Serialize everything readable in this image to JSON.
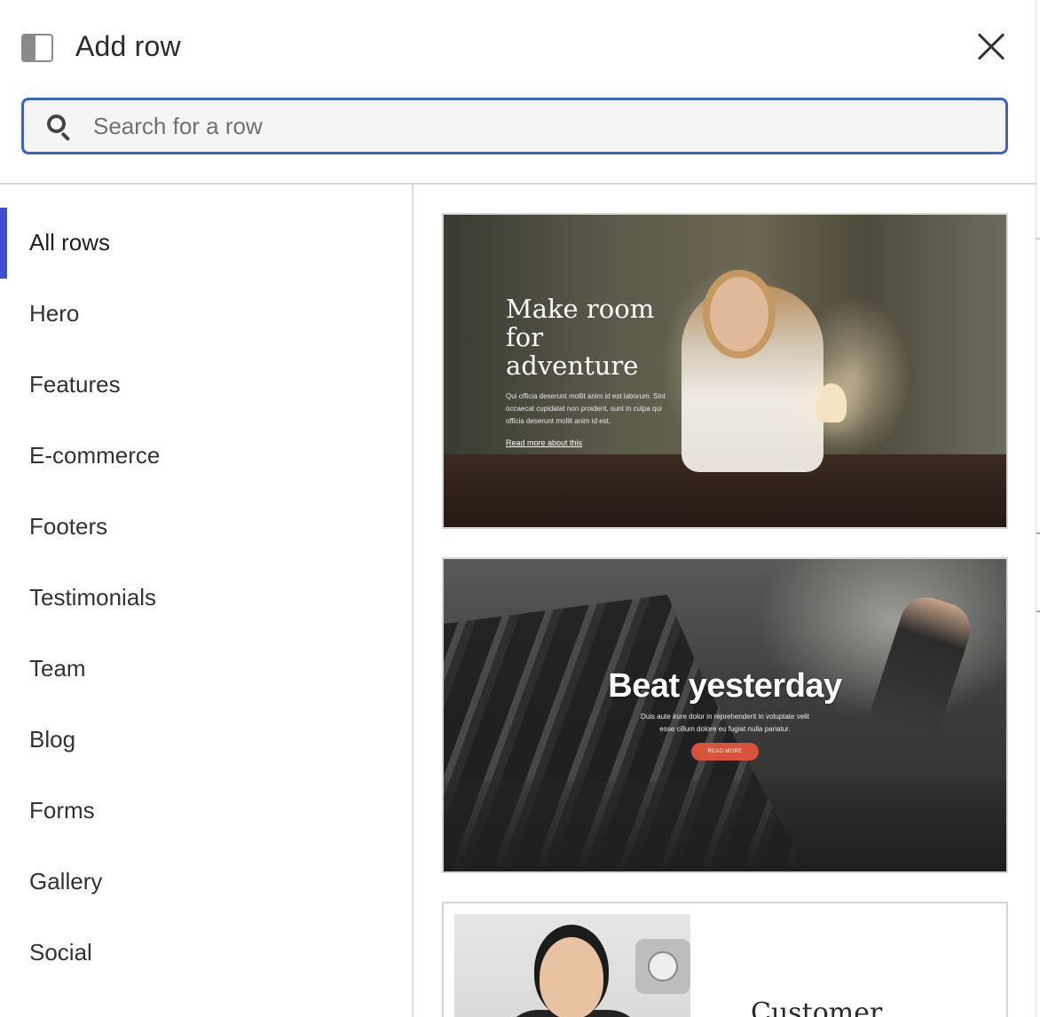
{
  "header": {
    "title": "Add row",
    "panel_icon": "sidebar-panel-icon",
    "close_icon": "close-icon"
  },
  "search": {
    "placeholder": "Search for a row",
    "value": "",
    "icon": "search-icon"
  },
  "sidebar": {
    "active_index": 0,
    "items": [
      {
        "label": "All rows"
      },
      {
        "label": "Hero"
      },
      {
        "label": "Features"
      },
      {
        "label": "E-commerce"
      },
      {
        "label": "Footers"
      },
      {
        "label": "Testimonials"
      },
      {
        "label": "Team"
      },
      {
        "label": "Blog"
      },
      {
        "label": "Forms"
      },
      {
        "label": "Gallery"
      },
      {
        "label": "Social"
      }
    ]
  },
  "thumbnails": [
    {
      "heading": "Make room for adventure",
      "paragraph": "Qui officia deserunt mollit anim id est laborum. Sint occaecat cupidatat non proident, sunt in culpa qui officia deserunt mollit anim id est.",
      "link": "Read more about this"
    },
    {
      "heading": "Beat yesterday",
      "paragraph": "Duis aute irure dolor in reprehenderit in voluptate velit esse cillum dolore eu fugiat nulla pariatur.",
      "button": "READ MORE",
      "button_color": "#d9533c"
    },
    {
      "heading": "Customer"
    }
  ],
  "colors": {
    "accent": "#3c4fd0",
    "search_border": "#3b64c8"
  }
}
